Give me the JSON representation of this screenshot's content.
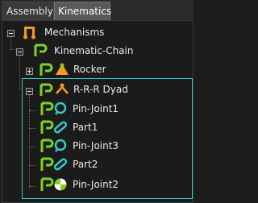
{
  "tabs": [
    {
      "label": "Assembly",
      "active": false
    },
    {
      "label": "Kinematics",
      "active": true
    }
  ],
  "tree": {
    "root": {
      "label": "Mechanisms",
      "icon": "mechanism-icon",
      "expanded": true
    },
    "chain": {
      "label": "Kinematic-Chain",
      "icon": "chain-link-icon",
      "expanded": true
    },
    "rocker": {
      "label": "Rocker",
      "icon": "rocker-icon",
      "expanded": false
    },
    "dyad": {
      "label": "R-R-R Dyad",
      "icon": "dyad-icon",
      "expanded": true,
      "selected": true
    },
    "dyad_children": [
      {
        "label": "Pin-Joint1",
        "icon": "pin-joint-icon"
      },
      {
        "label": "Part1",
        "icon": "part-link-icon"
      },
      {
        "label": "Pin-Joint3",
        "icon": "pin-joint-icon"
      },
      {
        "label": "Part2",
        "icon": "part-link-icon"
      },
      {
        "label": "Pin-Joint2",
        "icon": "ground-joint-icon"
      }
    ]
  },
  "colors": {
    "accent_green": "#7ed321",
    "accent_cyan": "#35c9c9",
    "mechanism_orange": "#f39a26",
    "selection_border": "#39c6c6"
  }
}
